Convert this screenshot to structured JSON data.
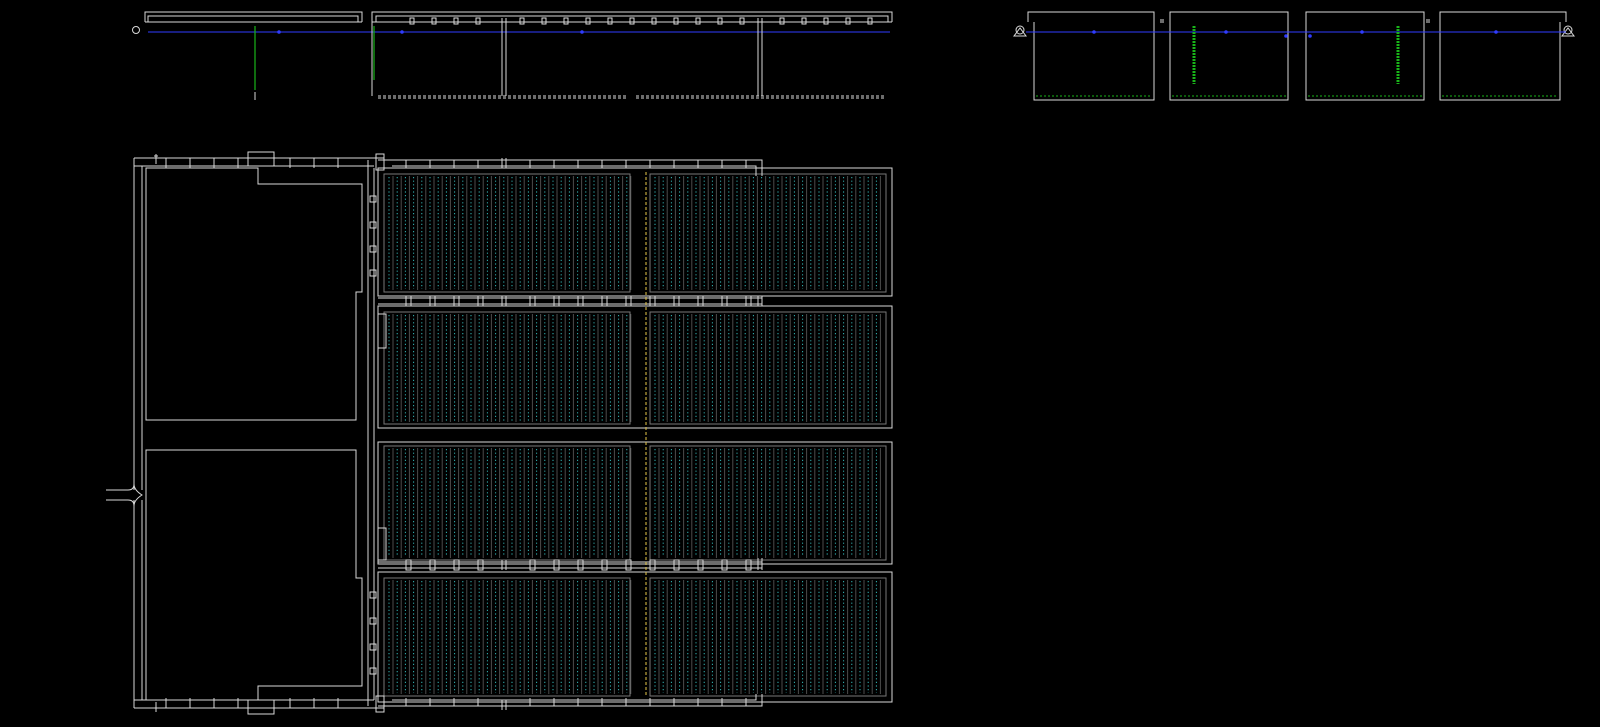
{
  "app": {
    "view": "cad-model-space"
  },
  "colors": {
    "background": "#000000",
    "outline": "#d9d9d9",
    "pipe_blue": "#2f3cff",
    "pipe_green": "#19b519",
    "diffuser_cyan": "#34b8b8",
    "axis_yellow": "#e6c84a"
  },
  "drawing": {
    "layers": [
      {
        "name": "outline",
        "color": "#d9d9d9"
      },
      {
        "name": "air-main",
        "color": "#2f3cff"
      },
      {
        "name": "drop-pipe",
        "color": "#19b519"
      },
      {
        "name": "diffuser-grid",
        "color": "#34b8b8"
      },
      {
        "name": "centerline",
        "color": "#e6c84a"
      }
    ],
    "tank_cells": 4,
    "sections": [
      "plan-view",
      "section-left",
      "section-right"
    ]
  }
}
